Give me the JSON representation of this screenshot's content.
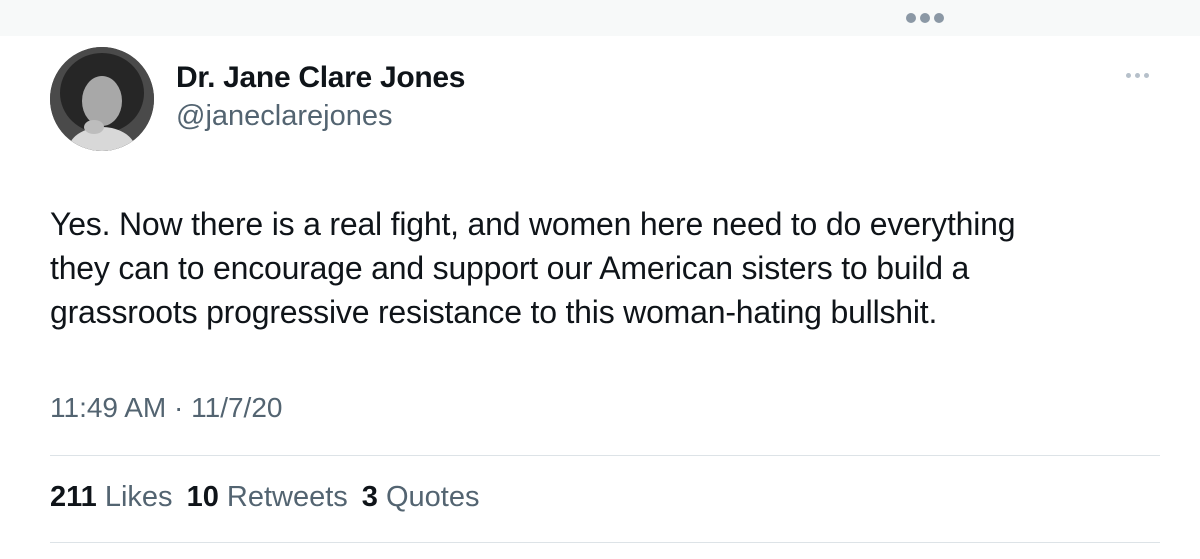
{
  "header": {
    "menu_icon": "more-horizontal-icon"
  },
  "tweet": {
    "author": {
      "display_name": "Dr. Jane Clare Jones",
      "handle": "@janeclarejones",
      "avatar_icon": "profile-photo"
    },
    "more_icon": "more-horizontal-icon",
    "text_lines": [
      "Yes. Now there is a real fight, and women here need to do everything",
      "they can to encourage and support our American sisters to build a",
      "grassroots progressive resistance to this woman-hating bullshit."
    ],
    "time": "11:49 AM",
    "separator": "·",
    "date": "11/7/20",
    "stats": {
      "likes_count": "211",
      "likes_label": "Likes",
      "retweets_count": "10",
      "retweets_label": "Retweets",
      "quotes_count": "3",
      "quotes_label": "Quotes"
    }
  },
  "colors": {
    "text_primary": "#0f1419",
    "text_secondary": "#536471",
    "divider": "#dde3e7",
    "header_bg": "#f7f9f9"
  }
}
